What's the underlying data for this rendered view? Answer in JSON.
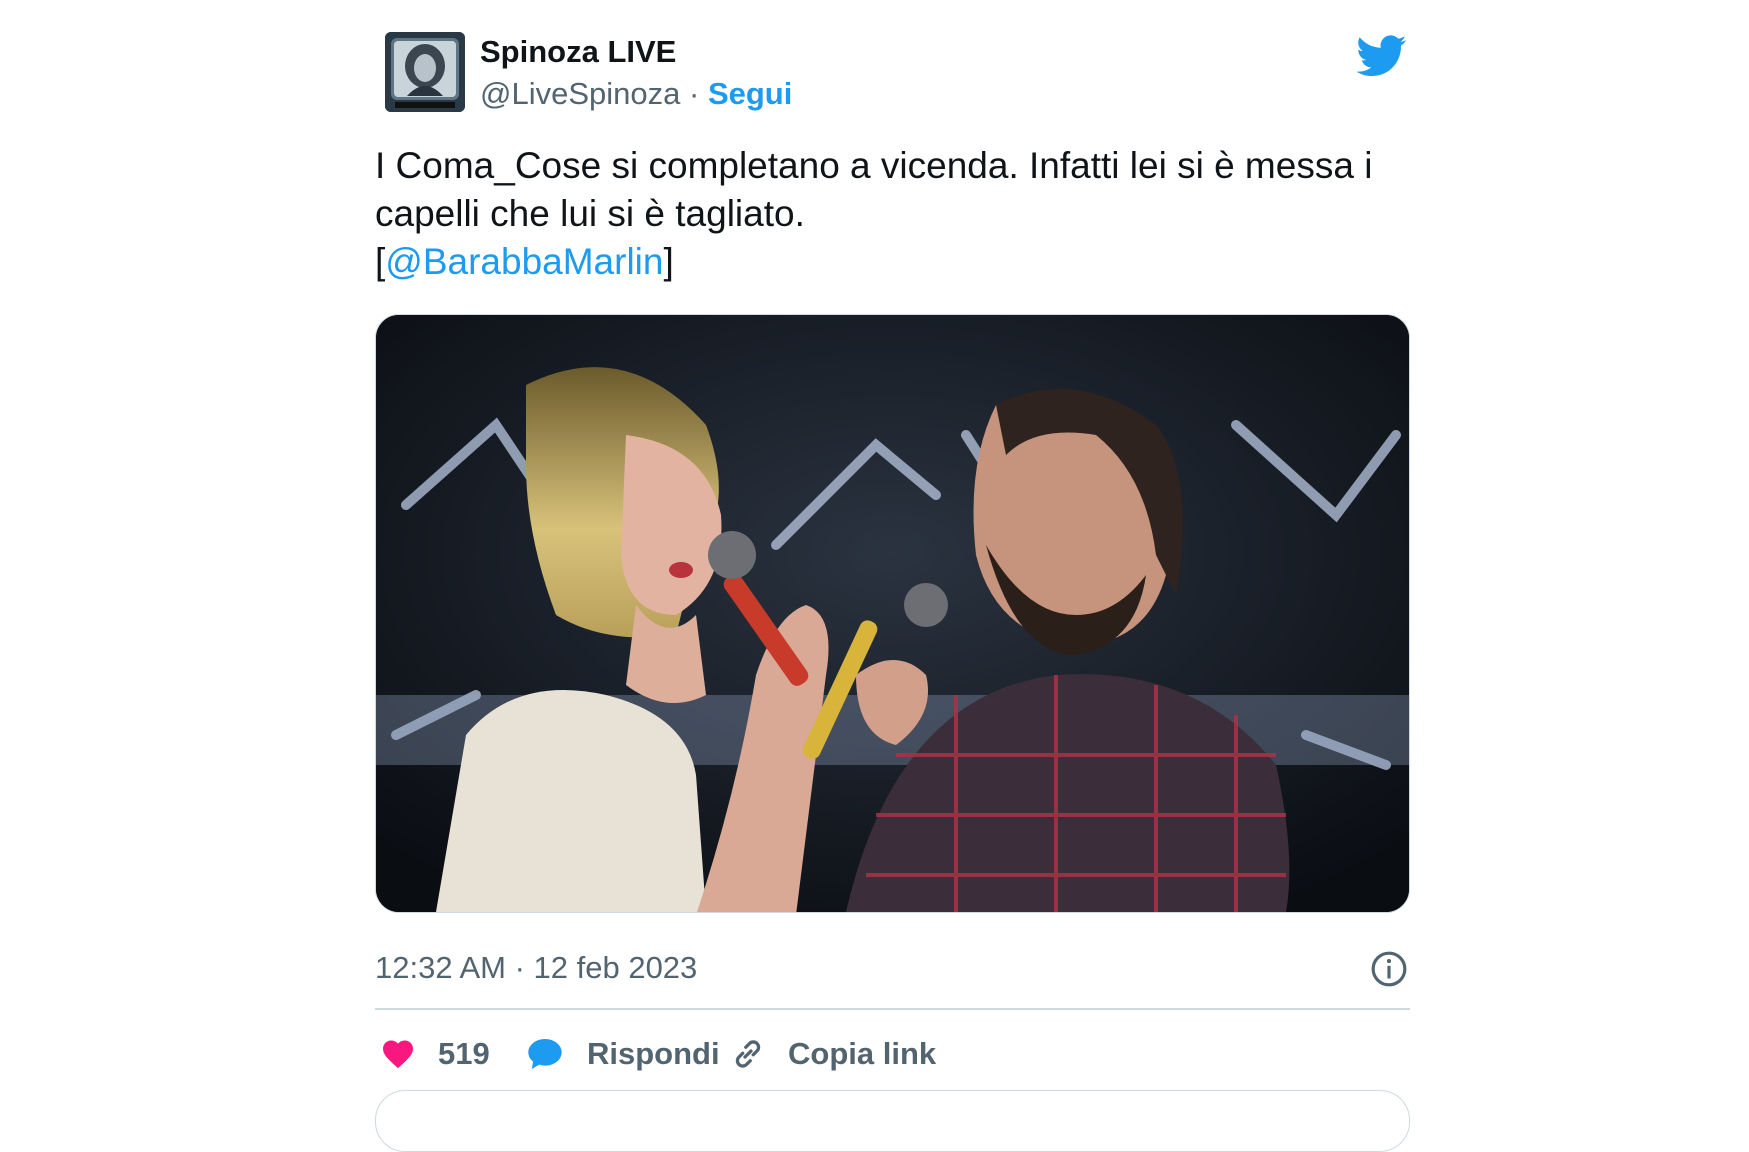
{
  "author": {
    "display_name": "Spinoza LIVE",
    "handle": "@LiveSpinoza",
    "separator": "·",
    "follow_label": "Segui"
  },
  "tweet": {
    "text_part1": "I Coma_Cose si completano a vicenda. Infatti lei si è messa i capelli che lui si è tagliato.",
    "bracket_open": "[",
    "mention": "@BarabbaMarlin",
    "bracket_close": "]"
  },
  "meta": {
    "timestamp": "12:32 AM · 12 feb 2023"
  },
  "actions": {
    "like_count": "519",
    "reply_label": "Rispondi",
    "copy_link_label": "Copia link"
  },
  "icons": {
    "brand": "twitter-bird-icon",
    "like": "heart-icon",
    "reply": "speech-bubble-icon",
    "copy": "link-icon",
    "info": "info-icon"
  },
  "colors": {
    "accent": "#1d9bf0",
    "like": "#f91880",
    "text": "#0f1419",
    "secondary": "#536471",
    "border": "#cfd9de"
  }
}
